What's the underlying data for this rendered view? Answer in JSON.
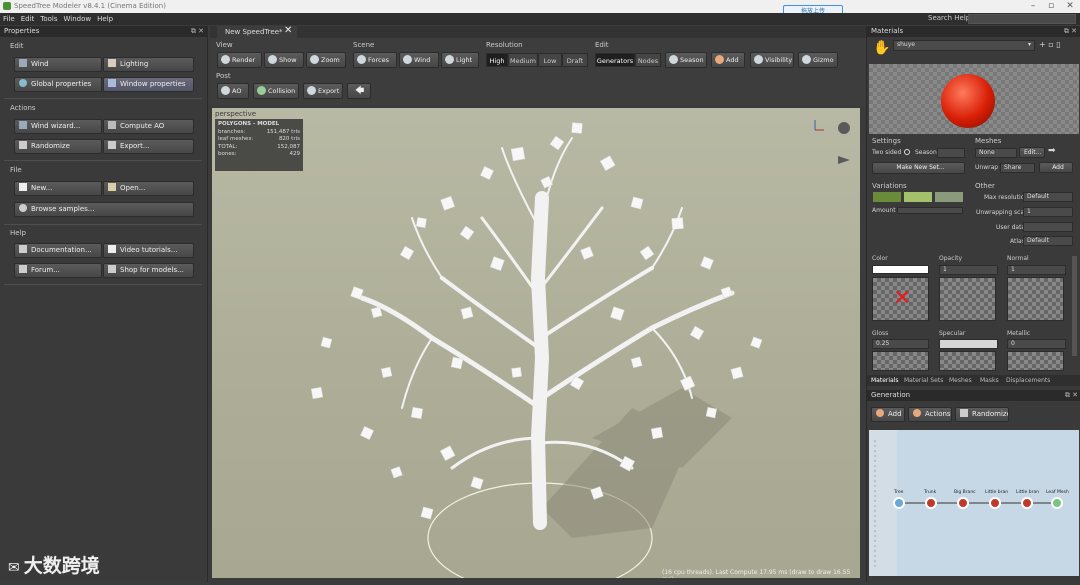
{
  "window": {
    "title": "SpeedTree Modeler v8.4.1 (Cinema Edition)",
    "upload_label": "拖放上传",
    "search_help_label": "Search Help:"
  },
  "menu": [
    "File",
    "Edit",
    "Tools",
    "Window",
    "Help"
  ],
  "left_panel": {
    "title": "Properties",
    "edit_label": "Edit",
    "wind": "Wind",
    "lighting": "Lighting",
    "global_properties": "Global properties",
    "window_properties": "Window properties",
    "actions_label": "Actions",
    "wind_wizard": "Wind wizard...",
    "compute_ao": "Compute AO",
    "randomize": "Randomize",
    "export": "Export...",
    "file_label": "File",
    "new": "New...",
    "open": "Open...",
    "browse_samples": "Browse samples...",
    "help_label": "Help",
    "documentation": "Documentation...",
    "video_tutorials": "Video tutorials...",
    "forum": "Forum...",
    "shop": "Shop for models..."
  },
  "document_tab": "New SpeedTree*",
  "toolbar": {
    "view_label": "View",
    "render": "Render",
    "show": "Show",
    "zoom": "Zoom",
    "scene_label": "Scene",
    "forces": "Forces",
    "wind": "Wind",
    "light": "Light",
    "resolution_label": "Resolution",
    "high": "High",
    "medium": "Medium",
    "low": "Low",
    "draft": "Draft",
    "edit_label": "Edit",
    "generators": "Generators",
    "nodes": "Nodes",
    "season": "Season",
    "add": "Add",
    "visibility": "Visibility",
    "gizmo": "Gizmo",
    "post_label": "Post",
    "ao": "AO",
    "collision": "Collision",
    "export": "Export"
  },
  "viewport": {
    "label": "perspective",
    "stats_title": "POLYGONS - MODEL",
    "stats": [
      {
        "k": "branches:",
        "v": "151,487 tris"
      },
      {
        "k": "leaf meshes:",
        "v": "820 tris"
      },
      {
        "k": "TOTAL:",
        "v": "152,087"
      },
      {
        "k": "",
        "v": ""
      },
      {
        "k": "bones:",
        "v": "429"
      }
    ],
    "status": "(16 cpu threads). Last Compute 17.95 ms (draw to draw 16.55 ms)"
  },
  "right_panel": {
    "materials_title": "Materials",
    "material_name": "shuye",
    "settings_label": "Settings",
    "two_sided": "Two sided",
    "season": "Season",
    "make_new_set": "Make New Set...",
    "meshes_label": "Meshes",
    "meshes_value": "None",
    "edit": "Edit...",
    "unwrap": "Unwrap",
    "unwrap_value": "Share",
    "add": "Add",
    "variations_label": "Variations",
    "amount": "Amount",
    "other_label": "Other",
    "max_resolution": "Max resolution",
    "max_resolution_value": "Default",
    "unwrapping_scale": "Unwrapping scale",
    "unwrapping_scale_value": "1",
    "user_data": "User data",
    "atlas": "Atlas",
    "atlas_value": "Default",
    "color_label": "Color",
    "opacity_label": "Opacity",
    "opacity_value": "1",
    "normal_label": "Normal",
    "normal_value": "1",
    "gloss_label": "Gloss",
    "gloss_value": "0.25",
    "specular_label": "Specular",
    "metallic_label": "Metallic",
    "metallic_value": "0",
    "tabs": [
      "Materials",
      "Material Sets",
      "Meshes",
      "Masks",
      "Displacements"
    ],
    "generation_title": "Generation",
    "gen_add": "Add",
    "gen_actions": "Actions",
    "gen_randomize": "Randomize",
    "nodes": [
      "Tree",
      "Trunk",
      "Big Branc",
      "Little bran",
      "Little bran",
      "Leaf Mesh"
    ]
  },
  "watermark": "大数跨境",
  "colors": {
    "accent": "#4a90d9",
    "viewport_bg": "#b3b39e",
    "node_red": "#c0392b"
  }
}
